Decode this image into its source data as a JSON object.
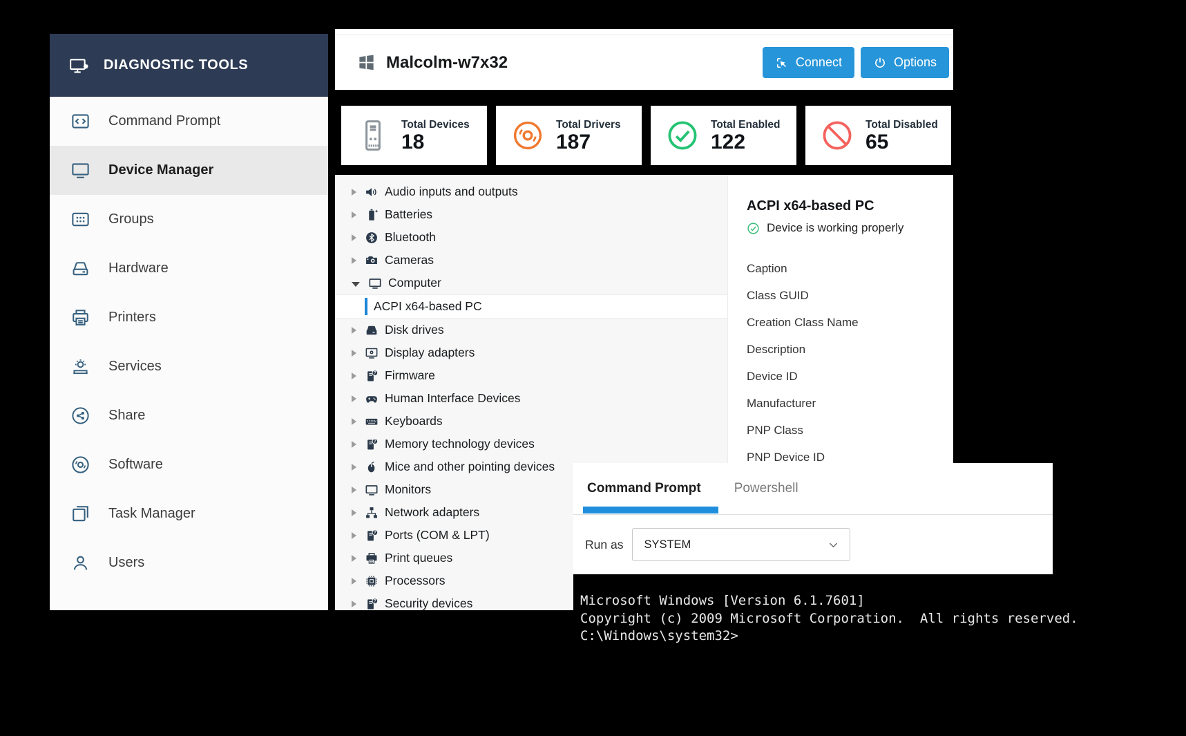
{
  "sidebar": {
    "title": "DIAGNOSTIC TOOLS",
    "title_icon": "monitor-star-icon",
    "items": [
      {
        "label": "Command Prompt",
        "icon": "code-icon",
        "selected": false
      },
      {
        "label": "Device Manager",
        "icon": "monitor-icon",
        "selected": true
      },
      {
        "label": "Groups",
        "icon": "grid-folder-icon",
        "selected": false
      },
      {
        "label": "Hardware",
        "icon": "drive-icon",
        "selected": false
      },
      {
        "label": "Printers",
        "icon": "printer-icon",
        "selected": false
      },
      {
        "label": "Services",
        "icon": "services-gear-icon",
        "selected": false
      },
      {
        "label": "Share",
        "icon": "share-icon",
        "selected": false
      },
      {
        "label": "Software",
        "icon": "disc-icon",
        "selected": false
      },
      {
        "label": "Task Manager",
        "icon": "windows-stack-icon",
        "selected": false
      },
      {
        "label": "Users",
        "icon": "user-icon",
        "selected": false
      }
    ]
  },
  "header": {
    "machine_name": "Malcolm-w7x32",
    "machine_icon": "windows-logo-icon",
    "connect_label": "Connect",
    "connect_icon": "connect-cursor-icon",
    "options_label": "Options",
    "options_icon": "power-icon"
  },
  "stats": [
    {
      "label": "Total Devices",
      "value": "18",
      "icon": "tower-pc-icon",
      "color": "#8d959c"
    },
    {
      "label": "Total Drivers",
      "value": "187",
      "icon": "disc-icon",
      "color": "#f0792f"
    },
    {
      "label": "Total Enabled",
      "value": "122",
      "icon": "check-circle-icon",
      "color": "#24c373"
    },
    {
      "label": "Total Disabled",
      "value": "65",
      "icon": "blocked-icon",
      "color": "#f4625e"
    }
  ],
  "device_tree": {
    "items": [
      {
        "label": "Audio inputs and outputs",
        "icon": "speaker-icon"
      },
      {
        "label": "Batteries",
        "icon": "battery-icon"
      },
      {
        "label": "Bluetooth",
        "icon": "bluetooth-icon"
      },
      {
        "label": "Cameras",
        "icon": "camera-icon"
      },
      {
        "label": "Computer",
        "icon": "computer-icon",
        "expanded": true
      },
      {
        "label": "ACPI x64-based PC",
        "child": true,
        "selected": true
      },
      {
        "label": "Disk drives",
        "icon": "disk-icon"
      },
      {
        "label": "Display adapters",
        "icon": "display-adapter-icon"
      },
      {
        "label": "Firmware",
        "icon": "firmware-icon"
      },
      {
        "label": "Human Interface Devices",
        "icon": "gamepad-icon"
      },
      {
        "label": "Keyboards",
        "icon": "keyboard-icon"
      },
      {
        "label": "Memory technology devices",
        "icon": "memory-icon"
      },
      {
        "label": "Mice and other pointing devices",
        "icon": "mouse-icon"
      },
      {
        "label": "Monitors",
        "icon": "monitors-icon"
      },
      {
        "label": "Network adapters",
        "icon": "network-icon"
      },
      {
        "label": "Ports (COM & LPT)",
        "icon": "ports-icon"
      },
      {
        "label": "Print queues",
        "icon": "print-queue-icon"
      },
      {
        "label": "Processors",
        "icon": "cpu-icon"
      },
      {
        "label": "Security devices",
        "icon": "security-icon"
      }
    ]
  },
  "device_detail": {
    "title": "ACPI x64-based PC",
    "status": "Device is working properly",
    "status_icon": "check-circle-icon",
    "fields": [
      "Caption",
      "Class GUID",
      "Creation Class Name",
      "Description",
      "Device ID",
      "Manufacturer",
      "PNP Class",
      "PNP Device ID"
    ]
  },
  "console": {
    "tabs": [
      {
        "label": "Command Prompt",
        "active": true
      },
      {
        "label": "Powershell",
        "active": false
      }
    ],
    "run_as_label": "Run as",
    "run_as_value": "SYSTEM",
    "run_as_chevron_icon": "chevron-down-icon",
    "terminal_lines": [
      "Microsoft Windows [Version 6.1.7601]",
      "Copyright (c) 2009 Microsoft Corporation.  All rights reserved.",
      "C:\\Windows\\system32>"
    ]
  },
  "colors": {
    "sidebar_header_bg": "#2d3b55",
    "sidebar_icon": "#35607f",
    "button_bg": "#2795d9",
    "tab_underline": "#1f8fdd",
    "tree_selected_bar": "#1d86d8",
    "status_green": "#3cbd7c",
    "stat_gray": "#8d959c",
    "stat_orange": "#f0792f",
    "stat_green": "#24c373",
    "stat_red": "#f4625e"
  }
}
